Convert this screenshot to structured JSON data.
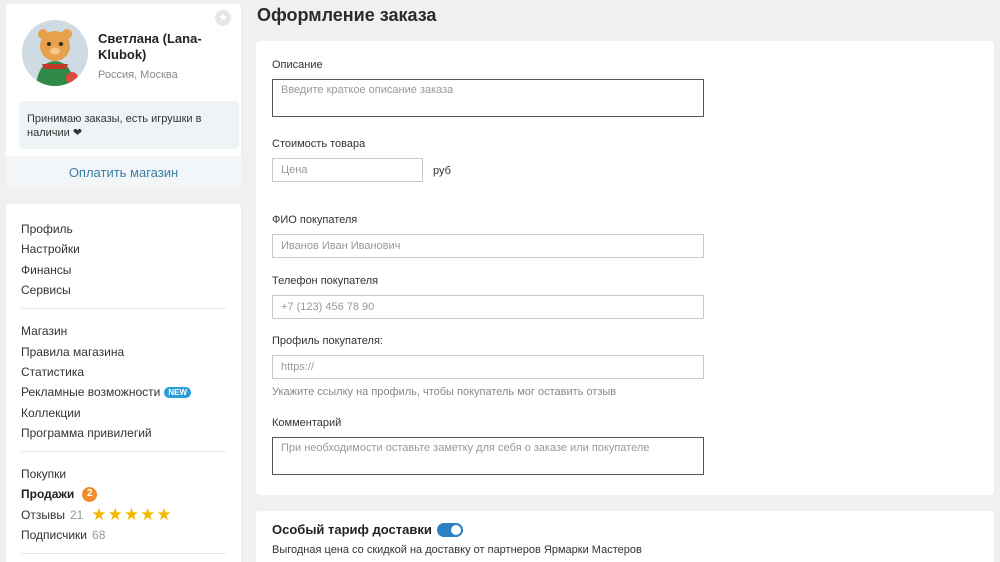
{
  "page": {
    "title": "Оформление заказа"
  },
  "profile": {
    "name": "Светлана (Lana-Klubok)",
    "location": "Россия, Москва",
    "about": "Принимаю заказы, есть игрушки в наличии ❤",
    "pay_label": "Оплатить магазин"
  },
  "menu": {
    "group1": [
      "Профиль",
      "Настройки",
      "Финансы",
      "Сервисы"
    ],
    "group2": [
      "Магазин",
      "Правила магазина",
      "Статистика",
      "Рекламные возможности",
      "Коллекции",
      "Программа привилегий"
    ],
    "new_badge": "NEW",
    "group3": {
      "purchases": "Покупки",
      "sales": "Продажи",
      "sales_count": "2",
      "reviews": "Отзывы",
      "reviews_count": "21",
      "rating_stars": 5,
      "subscribers": "Подписчики",
      "subscribers_count": "68"
    }
  },
  "form": {
    "description_label": "Описание",
    "description_placeholder": "Введите краткое описание заказа",
    "price_label": "Стоимость товара",
    "price_placeholder": "Цена",
    "price_suffix": "руб",
    "buyer_name_label": "ФИО покупателя",
    "buyer_name_placeholder": "Иванов Иван Иванович",
    "buyer_phone_label": "Телефон покупателя",
    "buyer_phone_placeholder": "+7 (123) 456 78 90",
    "buyer_profile_label": "Профиль покупателя:",
    "buyer_profile_placeholder": "https://",
    "buyer_profile_hint": "Укажите ссылку на профиль, чтобы покупатель мог оставить отзыв",
    "comment_label": "Комментарий",
    "comment_placeholder": "При необходимости оставьте заметку для себя о заказе или покупателе"
  },
  "delivery": {
    "title": "Особый тариф доставки",
    "enabled": true,
    "description": "Выгодная цена со скидкой на доставку от партнеров Ярмарки Мастеров"
  },
  "colors": {
    "accent": "#2d7fc4",
    "link": "#3d7ea6",
    "star": "#f5b800",
    "badge_orange": "#f08c2c",
    "badge_blue": "#2d9cdb"
  }
}
